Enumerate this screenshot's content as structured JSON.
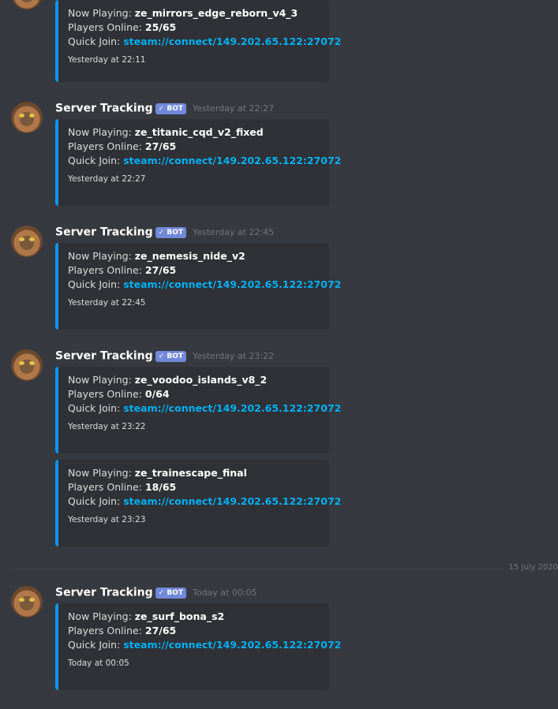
{
  "labels": {
    "now_playing": "Now Playing: ",
    "players_online": "Players Online: ",
    "quick_join": "Quick Join: "
  },
  "author": "Server Tracking",
  "bot_tag": "✓ BOT",
  "date_divider": "15 July 2020",
  "messages": [
    {
      "timestamp": "",
      "embeds": [
        {
          "map": "ze_mirrors_edge_reborn_v4_3",
          "players": "25/65",
          "link": "steam://connect/149.202.65.122:27072",
          "footer": "Yesterday at 22:11"
        }
      ]
    },
    {
      "timestamp": "Yesterday at 22:27",
      "embeds": [
        {
          "map": "ze_titanic_cqd_v2_fixed",
          "players": "27/65",
          "link": "steam://connect/149.202.65.122:27072",
          "footer": "Yesterday at 22:27"
        }
      ]
    },
    {
      "timestamp": "Yesterday at 22:45",
      "embeds": [
        {
          "map": "ze_nemesis_nide_v2",
          "players": "27/65",
          "link": "steam://connect/149.202.65.122:27072",
          "footer": "Yesterday at 22:45"
        }
      ]
    },
    {
      "timestamp": "Yesterday at 23:22",
      "embeds": [
        {
          "map": "ze_voodoo_islands_v8_2",
          "players": "0/64",
          "link": "steam://connect/149.202.65.122:27072",
          "footer": "Yesterday at 23:22"
        },
        {
          "map": "ze_trainescape_final",
          "players": "18/65",
          "link": "steam://connect/149.202.65.122:27072",
          "footer": "Yesterday at 23:23"
        }
      ]
    },
    {
      "timestamp": "Today at 00:05",
      "embeds": [
        {
          "map": "ze_surf_bona_s2",
          "players": "27/65",
          "link": "steam://connect/149.202.65.122:27072",
          "footer": "Today at 00:05"
        }
      ]
    }
  ],
  "colors": {
    "background": "#36393f",
    "embed_background": "#2f3136",
    "embed_border": "#0a97f5",
    "link": "#00b0f4",
    "bot_tag": "#7289da"
  }
}
